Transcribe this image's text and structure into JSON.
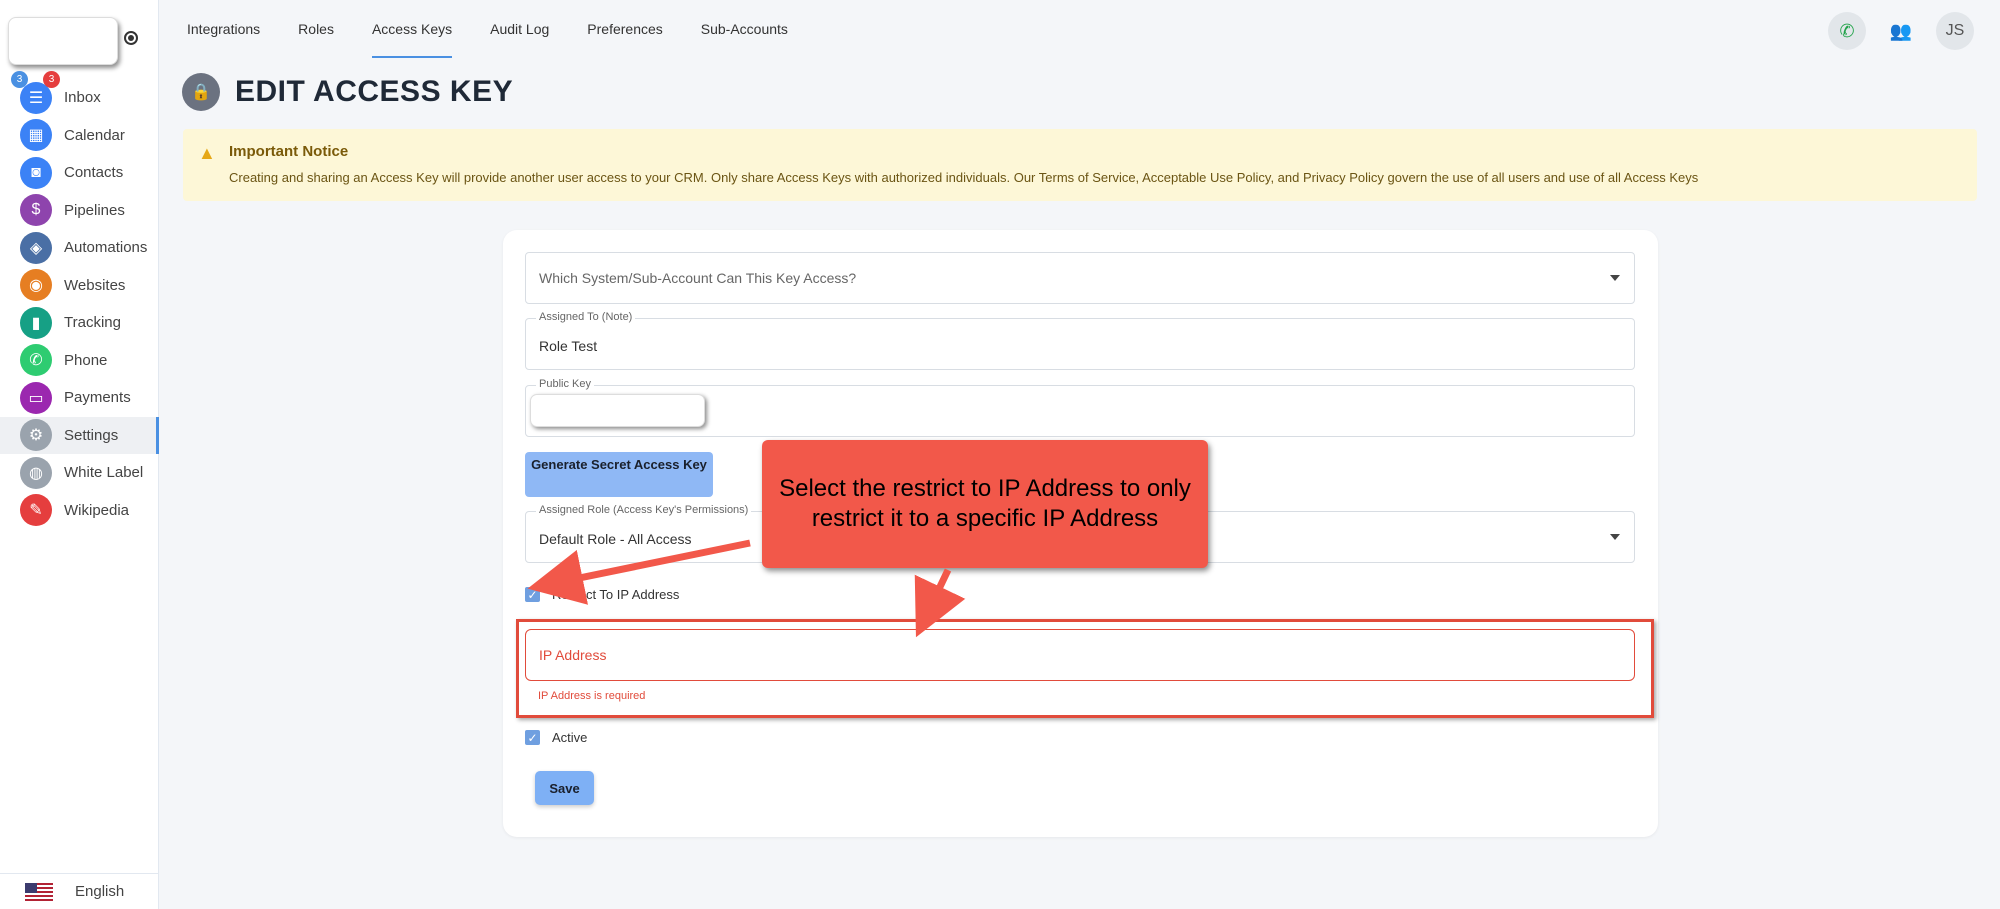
{
  "sidebar": {
    "items": [
      {
        "label": "Inbox",
        "icon": "inbox-icon",
        "color": "#3b82f6",
        "glyph": "☰",
        "badges": [
          "3",
          "3"
        ]
      },
      {
        "label": "Calendar",
        "icon": "calendar-icon",
        "color": "#3b82f6",
        "glyph": "▦"
      },
      {
        "label": "Contacts",
        "icon": "contacts-icon",
        "color": "#3b82f6",
        "glyph": "◙"
      },
      {
        "label": "Pipelines",
        "icon": "pipelines-icon",
        "color": "#8e44ad",
        "glyph": "$"
      },
      {
        "label": "Automations",
        "icon": "automations-icon",
        "color": "#4a6fa5",
        "glyph": "◈"
      },
      {
        "label": "Websites",
        "icon": "websites-icon",
        "color": "#e67e22",
        "glyph": "◉"
      },
      {
        "label": "Tracking",
        "icon": "tracking-icon",
        "color": "#16a085",
        "glyph": "▮"
      },
      {
        "label": "Phone",
        "icon": "phone-icon",
        "color": "#2ecc71",
        "glyph": "✆"
      },
      {
        "label": "Payments",
        "icon": "payments-icon",
        "color": "#9b27af",
        "glyph": "▭"
      },
      {
        "label": "Settings",
        "icon": "gear-icon",
        "color": "#9aa3ad",
        "glyph": "⚙"
      },
      {
        "label": "White Label",
        "icon": "palette-icon",
        "color": "#9aa3ad",
        "glyph": "◍"
      },
      {
        "label": "Wikipedia",
        "icon": "wikipedia-icon",
        "color": "#e53e3e",
        "glyph": "✎"
      }
    ],
    "language": "English"
  },
  "topnav": {
    "tabs": [
      "Integrations",
      "Roles",
      "Access Keys",
      "Audit Log",
      "Preferences",
      "Sub-Accounts"
    ],
    "active": "Access Keys",
    "avatar": "JS"
  },
  "page": {
    "title": "EDIT ACCESS KEY"
  },
  "notice": {
    "title": "Important Notice",
    "text": "Creating and sharing an Access Key will provide another user access to your CRM. Only share Access Keys with authorized individuals. Our Terms of Service, Acceptable Use Policy, and Privacy Policy govern the use of all users and use of all Access Keys"
  },
  "form": {
    "system_placeholder": "Which System/Sub-Account Can This Key Access?",
    "assigned_to_label": "Assigned To (Note)",
    "assigned_to_value": "Role Test",
    "public_key_label": "Public Key",
    "generate_button": "Generate Secret Access Key",
    "role_label": "Assigned Role (Access Key's Permissions)",
    "role_value": "Default Role - All Access",
    "restrict_ip_label": "Restrict To IP Address",
    "ip_placeholder": "IP Address",
    "ip_error": "IP Address is required",
    "active_label": "Active",
    "save_button": "Save"
  },
  "callout": {
    "text": "Select the restrict to IP Address to only restrict it to a specific IP Address",
    "color": "#f2584a"
  }
}
